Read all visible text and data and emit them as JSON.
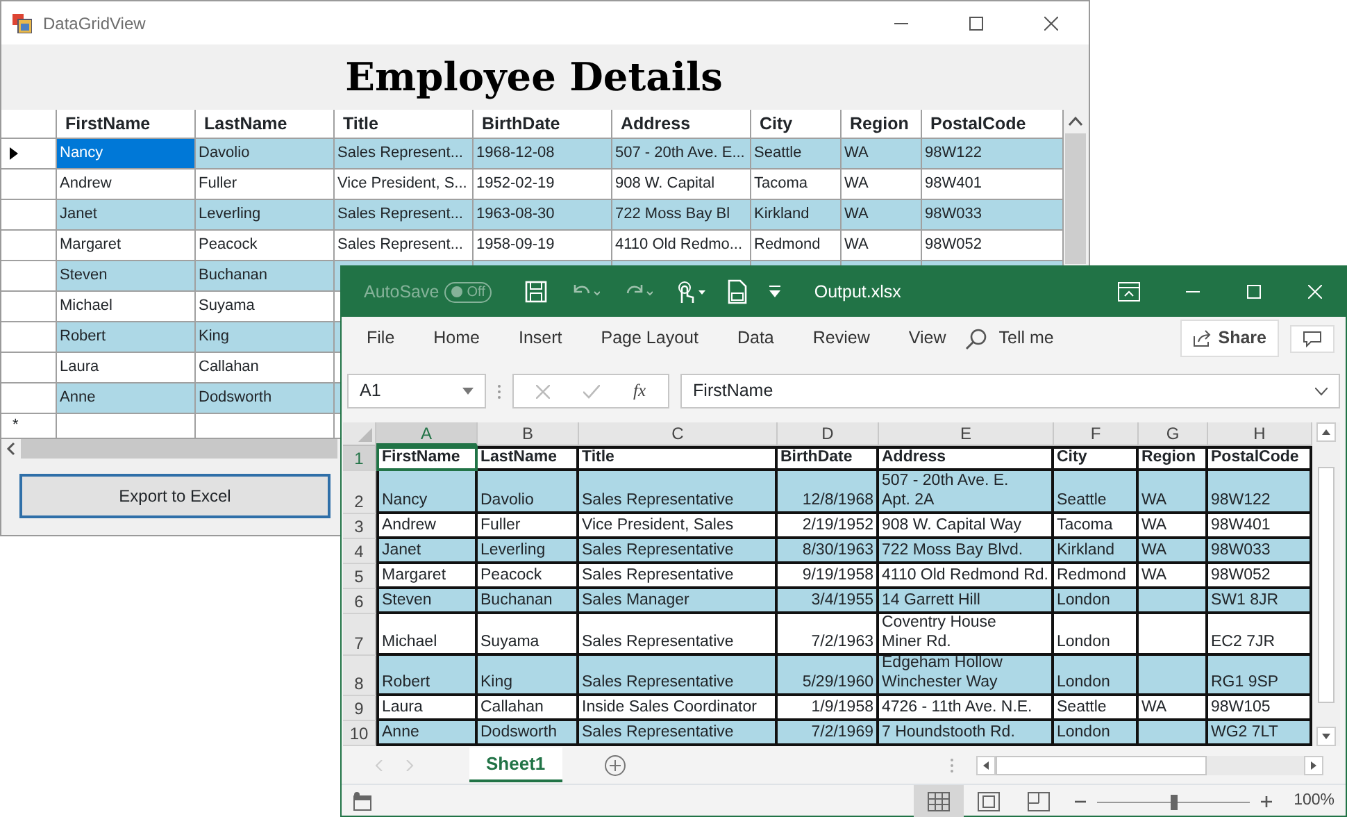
{
  "dgv_window": {
    "title": "DataGridView",
    "heading": "Employee Details",
    "columns": [
      "FirstName",
      "LastName",
      "Title",
      "BirthDate",
      "Address",
      "City",
      "Region",
      "PostalCode"
    ],
    "rows": [
      {
        "current": true,
        "color": "#add8e6",
        "cells": [
          "Nancy",
          "Davolio",
          "Sales Represent...",
          "1968-12-08",
          "507 - 20th Ave. E...",
          "Seattle",
          "WA",
          "98W122"
        ]
      },
      {
        "current": false,
        "color": "#ffffff",
        "cells": [
          "Andrew",
          "Fuller",
          "Vice President, S...",
          "1952-02-19",
          "908 W. Capital",
          "Tacoma",
          "WA",
          "98W401"
        ]
      },
      {
        "current": false,
        "color": "#add8e6",
        "cells": [
          "Janet",
          "Leverling",
          "Sales Represent...",
          "1963-08-30",
          "722 Moss Bay Bl",
          "Kirkland",
          "WA",
          "98W033"
        ]
      },
      {
        "current": false,
        "color": "#ffffff",
        "cells": [
          "Margaret",
          "Peacock",
          "Sales Represent...",
          "1958-09-19",
          "4110 Old Redmo...",
          "Redmond",
          "WA",
          "98W052"
        ]
      },
      {
        "current": false,
        "color": "#add8e6",
        "cells": [
          "Steven",
          "Buchanan"
        ]
      },
      {
        "current": false,
        "color": "#ffffff",
        "cells": [
          "Michael",
          "Suyama"
        ]
      },
      {
        "current": false,
        "color": "#add8e6",
        "cells": [
          "Robert",
          "King"
        ]
      },
      {
        "current": false,
        "color": "#ffffff",
        "cells": [
          "Laura",
          "Callahan"
        ]
      },
      {
        "current": false,
        "color": "#add8e6",
        "cells": [
          "Anne",
          "Dodsworth"
        ]
      }
    ],
    "new_row_marker": "*",
    "export_button": "Export to Excel"
  },
  "excel_window": {
    "autosave": {
      "label": "AutoSave",
      "state": "Off",
      "on": false
    },
    "file_name": "Output.xlsx",
    "ribbon_tabs": [
      "File",
      "Home",
      "Insert",
      "Page Layout",
      "Data",
      "Review",
      "View"
    ],
    "tell_me": "Tell me",
    "share": "Share",
    "name_box": "A1",
    "function_label": "fx",
    "formula": "FirstName",
    "columns": [
      {
        "letter": "A",
        "kind": "text",
        "selected": true
      },
      {
        "letter": "B",
        "kind": "text",
        "selected": false
      },
      {
        "letter": "C",
        "kind": "text",
        "selected": false
      },
      {
        "letter": "D",
        "kind": "date",
        "selected": false
      },
      {
        "letter": "E",
        "kind": "text",
        "selected": false
      },
      {
        "letter": "F",
        "kind": "text",
        "selected": false
      },
      {
        "letter": "G",
        "kind": "text",
        "selected": false
      },
      {
        "letter": "H",
        "kind": "text",
        "selected": false
      }
    ],
    "rows": [
      {
        "number": "1",
        "kind": "header",
        "selected": true,
        "color": "#ffffff",
        "cells": [
          "FirstName",
          "LastName",
          "Title",
          "BirthDate",
          "Address",
          "City",
          "Region",
          "PostalCode"
        ]
      },
      {
        "number": "2",
        "kind": "data",
        "selected": false,
        "color": "#add8e6",
        "cells": [
          "Nancy",
          "Davolio",
          "Sales Representative",
          "12/8/1968",
          "507 - 20th Ave. E.\nApt. 2A",
          "Seattle",
          "WA",
          "98W122"
        ]
      },
      {
        "number": "3",
        "kind": "data",
        "selected": false,
        "color": "#ffffff",
        "cells": [
          "Andrew",
          "Fuller",
          "Vice President, Sales",
          "2/19/1952",
          "908 W. Capital Way",
          "Tacoma",
          "WA",
          "98W401"
        ]
      },
      {
        "number": "4",
        "kind": "data",
        "selected": false,
        "color": "#add8e6",
        "cells": [
          "Janet",
          "Leverling",
          "Sales Representative",
          "8/30/1963",
          "722 Moss Bay Blvd.",
          "Kirkland",
          "WA",
          "98W033"
        ]
      },
      {
        "number": "5",
        "kind": "data",
        "selected": false,
        "color": "#ffffff",
        "cells": [
          "Margaret",
          "Peacock",
          "Sales Representative",
          "9/19/1958",
          "4110 Old Redmond Rd.",
          "Redmond",
          "WA",
          "98W052"
        ]
      },
      {
        "number": "6",
        "kind": "data",
        "selected": false,
        "color": "#add8e6",
        "cells": [
          "Steven",
          "Buchanan",
          "Sales Manager",
          "3/4/1955",
          "14 Garrett Hill",
          "London",
          "",
          "SW1 8JR"
        ]
      },
      {
        "number": "7",
        "kind": "data",
        "selected": false,
        "color": "#ffffff",
        "cells": [
          "Michael",
          "Suyama",
          "Sales Representative",
          "7/2/1963",
          "Coventry House\nMiner Rd.",
          "London",
          "",
          "EC2 7JR"
        ]
      },
      {
        "number": "8",
        "kind": "data",
        "selected": false,
        "color": "#add8e6",
        "cells": [
          "Robert",
          "King",
          "Sales Representative",
          "5/29/1960",
          "Edgeham Hollow\nWinchester Way",
          "London",
          "",
          "RG1 9SP"
        ]
      },
      {
        "number": "9",
        "kind": "data",
        "selected": false,
        "color": "#ffffff",
        "cells": [
          "Laura",
          "Callahan",
          "Inside Sales Coordinator",
          "1/9/1958",
          "4726 - 11th Ave. N.E.",
          "Seattle",
          "WA",
          "98W105"
        ]
      },
      {
        "number": "10",
        "kind": "data",
        "selected": false,
        "color": "#add8e6",
        "cells": [
          "Anne",
          "Dodsworth",
          "Sales Representative",
          "7/2/1969",
          "7 Houndstooth Rd.",
          "London",
          "",
          "WG2 7LT"
        ]
      }
    ],
    "sheet_tabs": [
      {
        "label": "Sheet1",
        "selected": true
      }
    ],
    "views": [
      {
        "kind": "normal",
        "selected": true
      },
      {
        "kind": "page-layout",
        "selected": false
      },
      {
        "kind": "page-break",
        "selected": false
      }
    ],
    "zoom": {
      "level": 0.5,
      "reading": "100%"
    }
  }
}
